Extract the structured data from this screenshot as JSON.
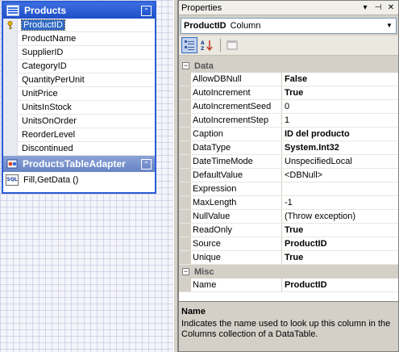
{
  "designer": {
    "table": {
      "title": "Products",
      "collapse_glyph": "⌃",
      "columns": [
        {
          "name": "ProductID",
          "key": true,
          "selected": true
        },
        {
          "name": "ProductName"
        },
        {
          "name": "SupplierID"
        },
        {
          "name": "CategoryID"
        },
        {
          "name": "QuantityPerUnit"
        },
        {
          "name": "UnitPrice"
        },
        {
          "name": "UnitsInStock"
        },
        {
          "name": "UnitsOnOrder"
        },
        {
          "name": "ReorderLevel"
        },
        {
          "name": "Discontinued"
        }
      ]
    },
    "adapter": {
      "title": "ProductsTableAdapter",
      "collapse_glyph": "⌃",
      "query": "Fill,GetData ()",
      "sql_icon_text": "SQL"
    }
  },
  "properties": {
    "title": "Properties",
    "title_buttons": [
      "▾",
      "⊣",
      "✕"
    ],
    "object_name": "ProductID",
    "object_type": "Column",
    "categories": [
      {
        "name": "Data",
        "toggle": "−",
        "rows": [
          {
            "name": "AllowDBNull",
            "value": "False",
            "bold": true
          },
          {
            "name": "AutoIncrement",
            "value": "True",
            "bold": true
          },
          {
            "name": "AutoIncrementSeed",
            "value": "0",
            "bold": false
          },
          {
            "name": "AutoIncrementStep",
            "value": "1",
            "bold": false
          },
          {
            "name": "Caption",
            "value": "ID del producto",
            "bold": true
          },
          {
            "name": "DataType",
            "value": "System.Int32",
            "bold": true
          },
          {
            "name": "DateTimeMode",
            "value": "UnspecifiedLocal",
            "bold": false
          },
          {
            "name": "DefaultValue",
            "value": "<DBNull>",
            "bold": false
          },
          {
            "name": "Expression",
            "value": "",
            "bold": false
          },
          {
            "name": "MaxLength",
            "value": "-1",
            "bold": false
          },
          {
            "name": "NullValue",
            "value": "(Throw exception)",
            "bold": false
          },
          {
            "name": "ReadOnly",
            "value": "True",
            "bold": true
          },
          {
            "name": "Source",
            "value": "ProductID",
            "bold": true
          },
          {
            "name": "Unique",
            "value": "True",
            "bold": true
          }
        ]
      },
      {
        "name": "Misc",
        "toggle": "−",
        "rows": [
          {
            "name": "Name",
            "value": "ProductID",
            "bold": true
          }
        ]
      }
    ],
    "description": {
      "title": "Name",
      "text": "Indicates the name used to look up this column in the Columns collection of a DataTable."
    }
  },
  "colors": {
    "table_header": "#1e4fc8",
    "adapter_header": "#6783c4",
    "selection": "#316ac5"
  }
}
